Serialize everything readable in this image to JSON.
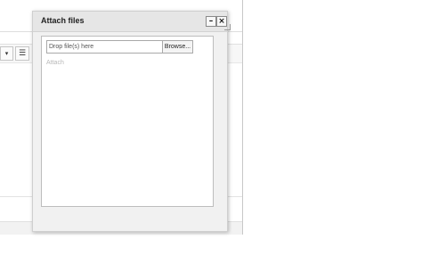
{
  "background": {
    "dropdown_icon": "caret-down-icon",
    "list_icon": "list-icon"
  },
  "dialog": {
    "title": "Attach files",
    "minimize_label": "–",
    "close_label": "×",
    "drop_placeholder": "Drop file(s) here",
    "browse_label": "Browse...",
    "attach_label": "Attach"
  }
}
